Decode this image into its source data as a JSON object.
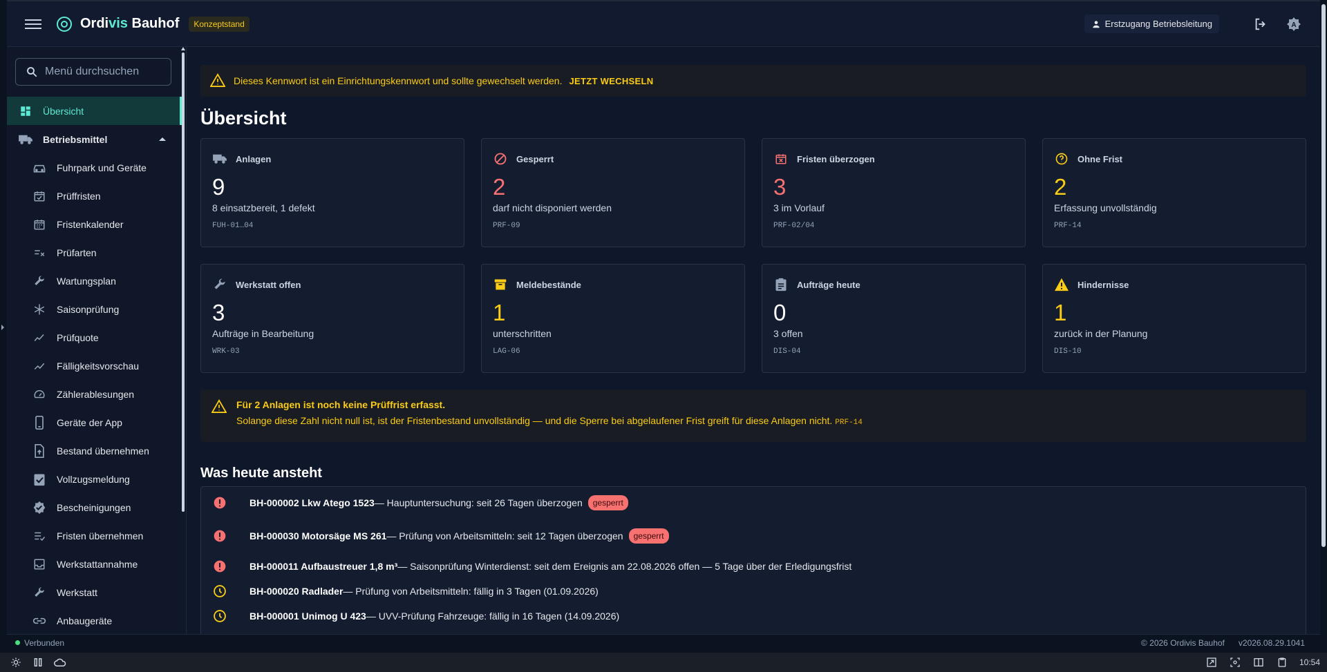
{
  "appbar": {
    "brand_prefix": "Ordi",
    "brand_accent": "vis",
    "brand_suffix": " Bauhof",
    "env_chip": "Konzeptstand",
    "user_label": "Erstzugang Betriebsleitung"
  },
  "sidebar": {
    "search_placeholder": "Menü durchsuchen",
    "items": [
      {
        "label": "Übersicht"
      },
      {
        "label": "Betriebsmittel"
      },
      {
        "label": "Fuhrpark und Geräte"
      },
      {
        "label": "Prüffristen"
      },
      {
        "label": "Fristenkalender"
      },
      {
        "label": "Prüfarten"
      },
      {
        "label": "Wartungsplan"
      },
      {
        "label": "Saisonprüfung"
      },
      {
        "label": "Prüfquote"
      },
      {
        "label": "Fälligkeitsvorschau"
      },
      {
        "label": "Zählerablesungen"
      },
      {
        "label": "Geräte der App"
      },
      {
        "label": "Bestand übernehmen"
      },
      {
        "label": "Vollzugsmeldung"
      },
      {
        "label": "Bescheinigungen"
      },
      {
        "label": "Fristen übernehmen"
      },
      {
        "label": "Werkstattannahme"
      },
      {
        "label": "Werkstatt"
      },
      {
        "label": "Anbaugeräte"
      }
    ]
  },
  "alert_top": {
    "text": "Dieses Kennwort ist ein Einrichtungskennwort und sollte gewechselt werden.",
    "action": "JETZT WECHSELN"
  },
  "page_title": "Übersicht",
  "cards": [
    {
      "title": "Anlagen",
      "value": "9",
      "sub": "8 einsatzbereit, 1 defekt",
      "code": "FUH-01…04",
      "icon": "truck-icon"
    },
    {
      "title": "Gesperrt",
      "value": "2",
      "sub": "darf nicht disponiert werden",
      "code": "PRF-09",
      "icon": "block-icon"
    },
    {
      "title": "Fristen überzogen",
      "value": "3",
      "sub": "3 im Vorlauf",
      "code": "PRF-02/04",
      "icon": "calendar-x-icon"
    },
    {
      "title": "Ohne Frist",
      "value": "2",
      "sub": "Erfassung unvollständig",
      "code": "PRF-14",
      "icon": "question-icon"
    },
    {
      "title": "Werkstatt offen",
      "value": "3",
      "sub": "Aufträge in Bearbeitung",
      "code": "WRK-03",
      "icon": "wrench-icon"
    },
    {
      "title": "Meldebestände",
      "value": "1",
      "sub": "unterschritten",
      "code": "LAG-06",
      "icon": "archive-icon"
    },
    {
      "title": "Aufträge heute",
      "value": "0",
      "sub": "3 offen",
      "code": "DIS-04",
      "icon": "clipboard-icon"
    },
    {
      "title": "Hindernisse",
      "value": "1",
      "sub": "zurück in der Planung",
      "code": "DIS-10",
      "icon": "warning-icon"
    }
  ],
  "alert_mid": {
    "title": "Für 2 Anlagen ist noch keine Prüffrist erfasst.",
    "body": "Solange diese Zahl nicht null ist, ist der Fristenbestand unvollständig — und die Sperre bei abgelaufener Frist greift für diese Anlagen nicht.",
    "code": "PRF-14"
  },
  "today": {
    "title": "Was heute ansteht",
    "rows": [
      {
        "name": "BH-000002 Lkw Atego 1523",
        "text": " — Hauptuntersuchung: seit 26 Tagen überzogen",
        "badge": "gesperrt",
        "icon": "error-icon"
      },
      {
        "name": "BH-000030 Motorsäge MS 261",
        "text": " — Prüfung von Arbeitsmitteln: seit 12 Tagen überzogen",
        "badge": "gesperrt",
        "icon": "error-icon"
      },
      {
        "name": "BH-000011 Aufbaustreuer 1,8 m³",
        "text": " — Saisonprüfung Winterdienst: seit dem Ereignis am 22.08.2026 offen — 5 Tage über der Erledigungsfrist",
        "badge": "",
        "icon": "error-icon"
      },
      {
        "name": "BH-000020 Radlader",
        "text": " — Prüfung von Arbeitsmitteln: fällig in 3 Tagen (01.09.2026)",
        "badge": "",
        "icon": "clock-icon"
      },
      {
        "name": "BH-000001 Unimog U 423",
        "text": " — UVV-Prüfung Fahrzeuge: fällig in 16 Tagen (14.09.2026)",
        "badge": "",
        "icon": "clock-icon"
      }
    ]
  },
  "statusbar": {
    "connection": "Verbunden",
    "copyright": "© 2026 Ordivis Bauhof",
    "version": "v2026.08.29.1041"
  },
  "taskbar": {
    "clock": "10:54"
  },
  "colors": {
    "accent": "#5eead4",
    "warning": "#facc15",
    "danger": "#f87171"
  }
}
